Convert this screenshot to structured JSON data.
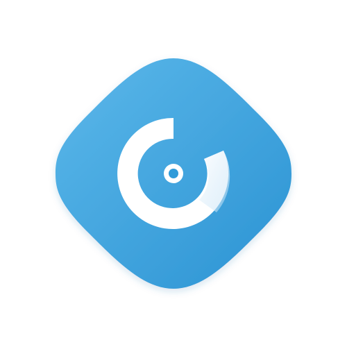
{
  "logo": {
    "icon": "camera-lens-logo-icon",
    "colors": {
      "background": "#ffffff",
      "tile_light": "#5cb8ea",
      "tile_dark": "#2b93d3",
      "ring": "#ffffff",
      "ring_fade": "#cfe6f6",
      "center": "#2f9bd9"
    }
  }
}
